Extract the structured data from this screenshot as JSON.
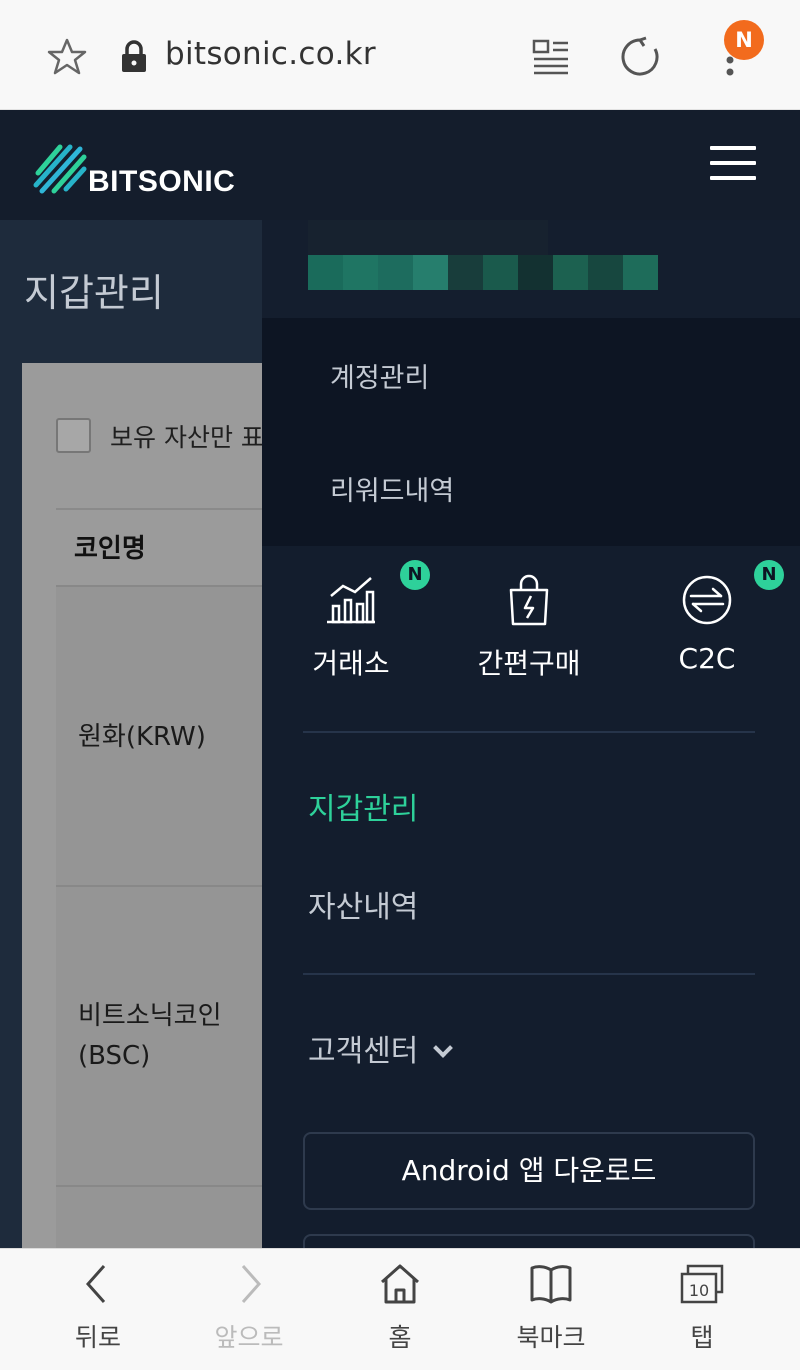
{
  "browser": {
    "url": "bitsonic.co.kr",
    "notification_badge": "N",
    "bottom_nav": [
      {
        "label": "뒤로",
        "icon": "back-arrow-icon",
        "enabled": true
      },
      {
        "label": "앞으로",
        "icon": "forward-arrow-icon",
        "enabled": false
      },
      {
        "label": "홈",
        "icon": "home-icon",
        "enabled": true
      },
      {
        "label": "북마크",
        "icon": "bookmark-icon",
        "enabled": true
      },
      {
        "label": "탭",
        "icon": "tabs-icon",
        "enabled": true,
        "count": "10"
      }
    ]
  },
  "site": {
    "logo_text": "BITSONIC"
  },
  "page": {
    "title": "지갑관리",
    "filter_checkbox_label": "보유 자산만 표",
    "column_header": "코인명",
    "rows": [
      {
        "name_line1": "원화(KRW)",
        "name_line2": ""
      },
      {
        "name_line1": "비트소닉코인",
        "name_line2": "(BSC)"
      }
    ]
  },
  "menu": {
    "submenu": [
      "계정관리",
      "리워드내역"
    ],
    "quick_links": [
      {
        "label": "거래소",
        "icon": "exchange-chart-icon",
        "badge": "N"
      },
      {
        "label": "간편구매",
        "icon": "shopping-bag-icon",
        "badge": ""
      },
      {
        "label": "C2C",
        "icon": "c2c-swap-icon",
        "badge": "N"
      }
    ],
    "items": [
      {
        "label": "지갑관리",
        "active": true
      },
      {
        "label": "자산내역",
        "active": false
      }
    ],
    "support": "고객센터",
    "android_button": "Android 앱 다운로드"
  },
  "colors": {
    "accent": "#2ed19a",
    "menu_bg": "#131d2d",
    "header_bg": "#141d2c",
    "notification": "#f26b1d"
  }
}
